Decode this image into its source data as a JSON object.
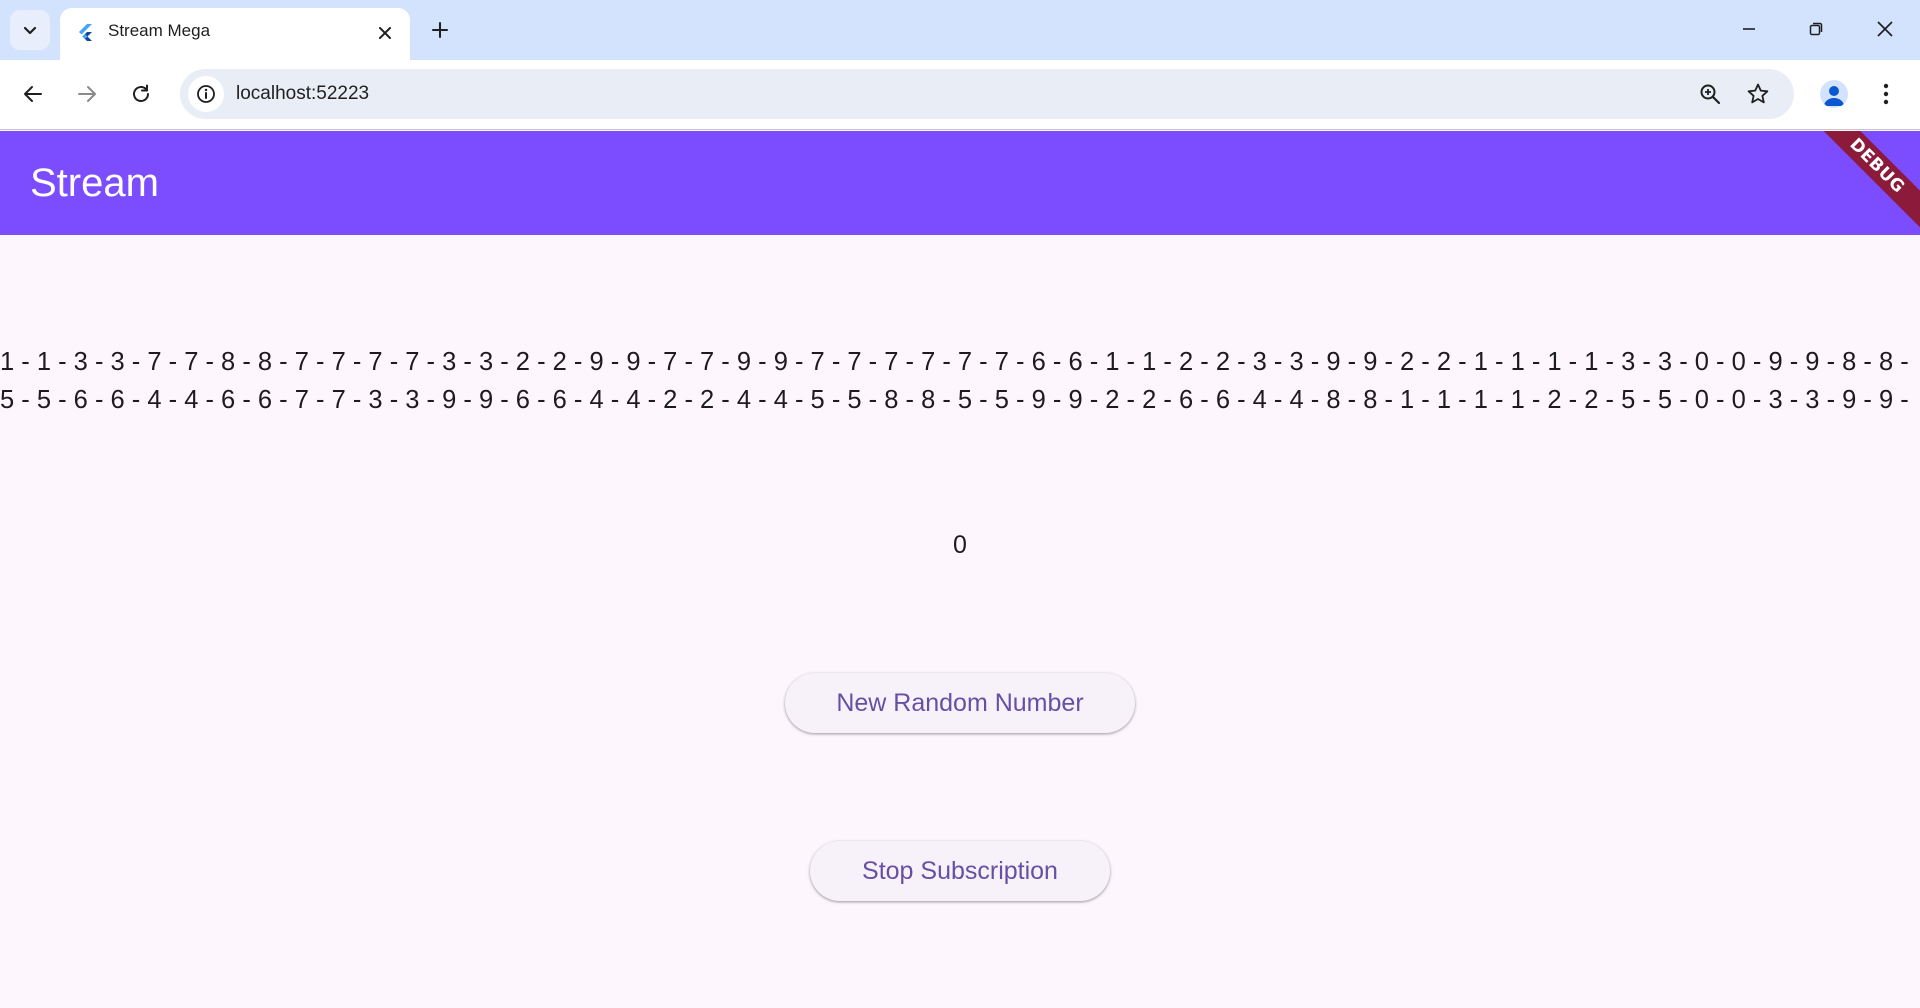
{
  "browser": {
    "tab": {
      "title": "Stream Mega",
      "favicon": "flutter-icon"
    },
    "address_bar": {
      "url": "localhost:52223"
    },
    "icons": {
      "tab_search": "chevron-down-icon",
      "tab_close": "close-icon",
      "new_tab": "plus-icon",
      "minimize": "minimize-icon",
      "restore": "restore-icon",
      "close_window": "close-icon",
      "back": "arrow-left-icon",
      "forward": "arrow-right-icon",
      "reload": "reload-icon",
      "site_info": "info-icon",
      "zoom": "zoom-icon",
      "bookmark": "star-icon",
      "profile": "profile-icon",
      "menu": "more-vert-icon"
    }
  },
  "app": {
    "title": "Stream",
    "debug_banner": "DEBUG",
    "sequence_lines": [
      "1 - 1 - 3 - 3 - 7 - 7 - 8 - 8 - 7 - 7 - 7 - 7 - 3 - 3 - 2 - 2 - 9 - 9 - 7 - 7 - 9 - 9 - 7 - 7 - 7 - 7 - 7 - 7 - 6 - 6 - 1 - 1 - 2 - 2 - 3 - 3 - 9 - 9 - 2 - 2 - 1 - 1 - 1 - 1 - 3 - 3 - 0 - 0 - 9 - 9 - 8 - 8 -",
      "5 - 5 - 6 - 6 - 4 - 4 - 6 - 6 - 7 - 7 - 3 - 3 - 9 - 9 - 6 - 6 - 4 - 4 - 2 - 2 - 4 - 4 - 5 - 5 - 8 - 8 - 5 - 5 - 9 - 9 - 2 - 2 - 6 - 6 - 4 - 4 - 8 - 8 - 1 - 1 - 1 - 1 - 2 - 2 - 5 - 5 - 0 - 0 - 3 - 3 - 9 - 9 -"
    ],
    "current_number": "0",
    "buttons": {
      "new_random": "New Random Number",
      "stop_subscription": "Stop Subscription"
    },
    "colors": {
      "appbar": "#7c4dff",
      "background": "#fdf7fd",
      "button_text": "#6750a4",
      "debug_banner": "#8b1a3b"
    }
  }
}
